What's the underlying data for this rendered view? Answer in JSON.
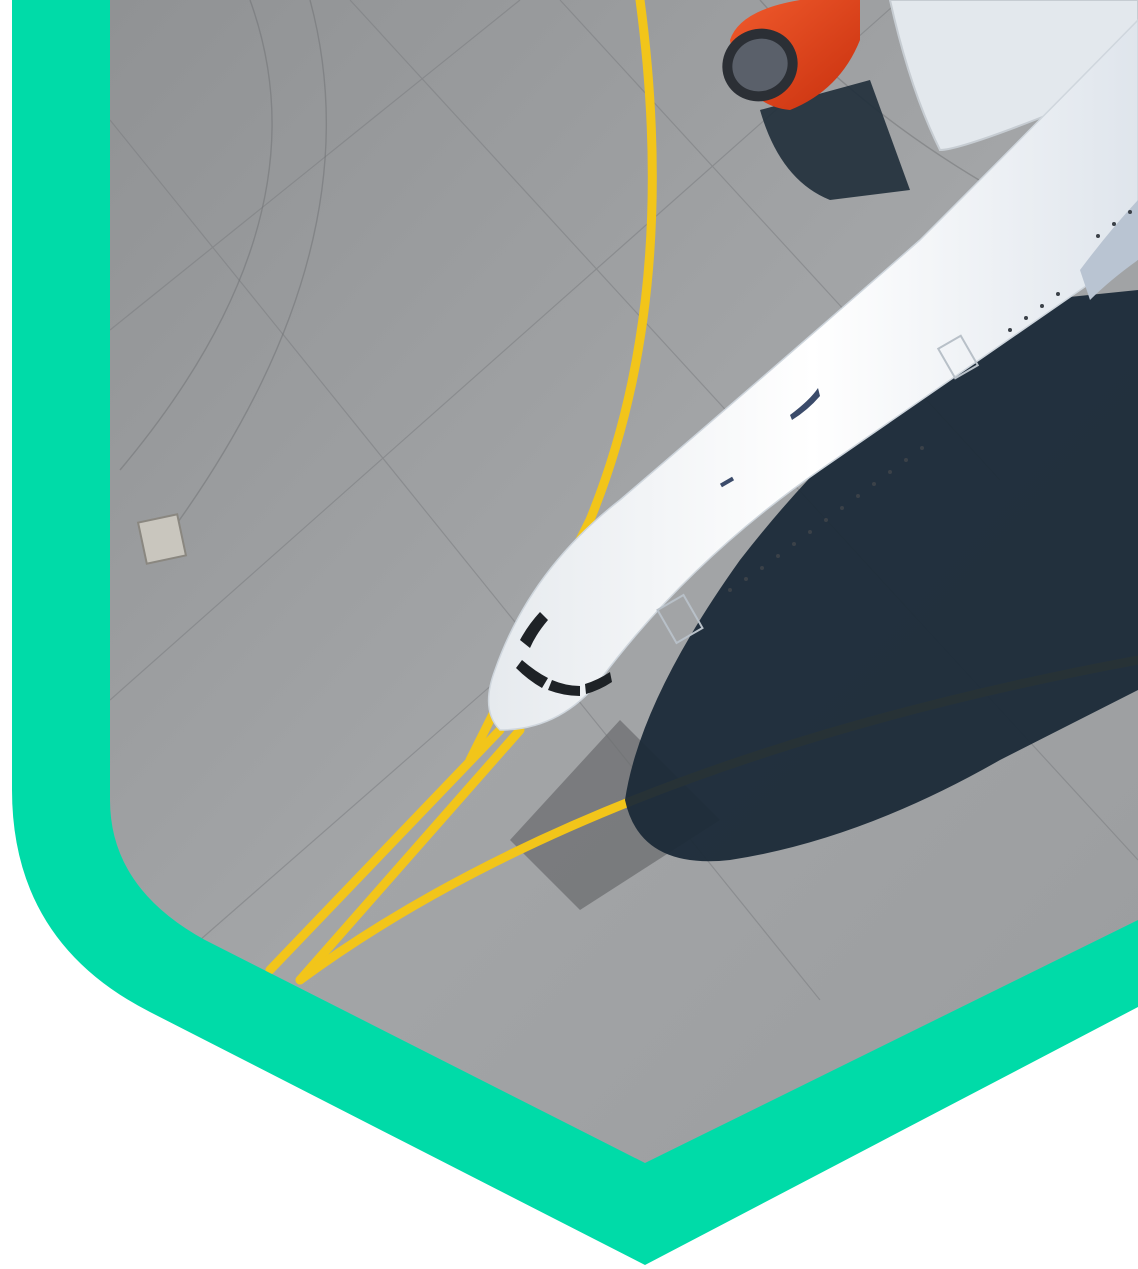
{
  "frame": {
    "accent_color": "#00dba8",
    "background_color": "#ffffff",
    "shape": "shield-hexagon"
  },
  "photo": {
    "subject": "aerial-view-airliner-on-tarmac",
    "tarmac_color": "#9a9c9e",
    "taxi_line_color": "#f2c51a",
    "fuselage_color": "#f4f6f8",
    "engine_color": "#e8401c",
    "shadow_color": "#1b2a38"
  }
}
